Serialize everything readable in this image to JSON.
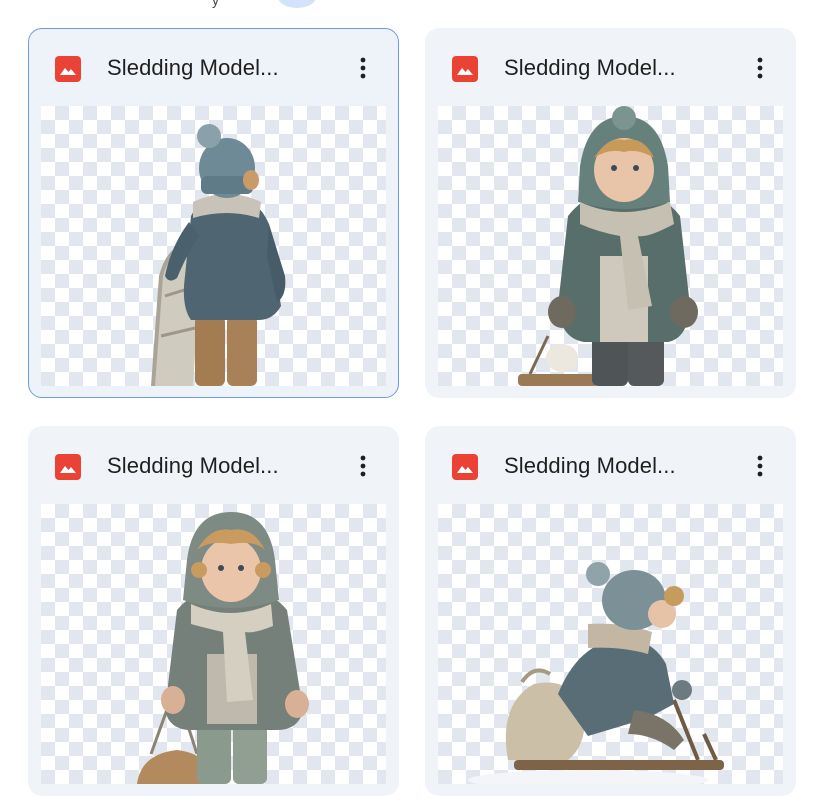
{
  "top_partial_text": "y",
  "cards": [
    {
      "title": "Sledding Model...",
      "selected": true,
      "icon": "image-file-icon",
      "thumbnail": "child-back-view-with-sled"
    },
    {
      "title": "Sledding Model...",
      "selected": false,
      "icon": "image-file-icon",
      "thumbnail": "child-front-view-scarf-with-sled"
    },
    {
      "title": "Sledding Model...",
      "selected": false,
      "icon": "image-file-icon",
      "thumbnail": "child-hooded-coat-with-sled"
    },
    {
      "title": "Sledding Model...",
      "selected": false,
      "icon": "image-file-icon",
      "thumbnail": "child-sitting-on-sled"
    }
  ],
  "colors": {
    "card_bg": "#f0f4f9",
    "selected_border": "#6b9af0",
    "file_icon": "#ea4335",
    "checker": "#e2e6ee"
  }
}
